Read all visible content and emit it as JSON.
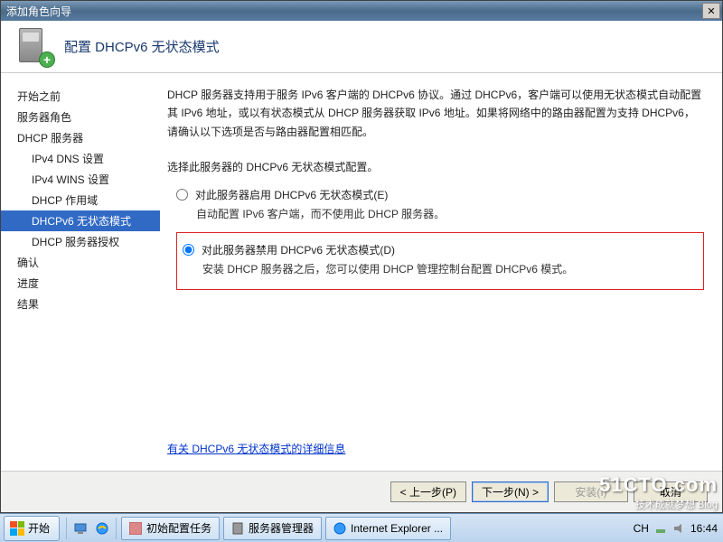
{
  "titlebar": {
    "text": "添加角色向导"
  },
  "header": {
    "title": "配置 DHCPv6 无状态模式"
  },
  "sidebar": {
    "items": [
      {
        "label": "开始之前",
        "level": 0
      },
      {
        "label": "服务器角色",
        "level": 0
      },
      {
        "label": "DHCP 服务器",
        "level": 0
      },
      {
        "label": "IPv4 DNS 设置",
        "level": 1
      },
      {
        "label": "IPv4 WINS 设置",
        "level": 1
      },
      {
        "label": "DHCP 作用域",
        "level": 1
      },
      {
        "label": "DHCPv6 无状态模式",
        "level": 1,
        "selected": true
      },
      {
        "label": "DHCP 服务器授权",
        "level": 1
      },
      {
        "label": "确认",
        "level": 0
      },
      {
        "label": "进度",
        "level": 0
      },
      {
        "label": "结果",
        "level": 0
      }
    ]
  },
  "content": {
    "description": "DHCP 服务器支持用于服务 IPv6 客户端的 DHCPv6 协议。通过 DHCPv6，客户端可以使用无状态模式自动配置其 IPv6 地址，或以有状态模式从 DHCP 服务器获取 IPv6 地址。如果将网络中的路由器配置为支持 DHCPv6，请确认以下选项是否与路由器配置相匹配。",
    "prompt": "选择此服务器的 DHCPv6 无状态模式配置。",
    "options": [
      {
        "label": "对此服务器启用 DHCPv6 无状态模式(E)",
        "sub": "自动配置 IPv6 客户端，而不使用此 DHCP 服务器。",
        "checked": false
      },
      {
        "label": "对此服务器禁用 DHCPv6 无状态模式(D)",
        "sub": "安装 DHCP 服务器之后，您可以使用 DHCP 管理控制台配置 DHCPv6 模式。",
        "checked": true
      }
    ],
    "link": "有关 DHCPv6 无状态模式的详细信息"
  },
  "footer": {
    "prev": "< 上一步(P)",
    "next": "下一步(N) >",
    "install": "安装(I)",
    "cancel": "取消"
  },
  "taskbar": {
    "start": "开始",
    "tasks": [
      {
        "label": "初始配置任务"
      },
      {
        "label": "服务器管理器"
      },
      {
        "label": "Internet Explorer ..."
      }
    ],
    "clock": "16:44"
  },
  "watermark": {
    "big": "51CTO.com",
    "small": "技术成就梦想 Blog"
  }
}
